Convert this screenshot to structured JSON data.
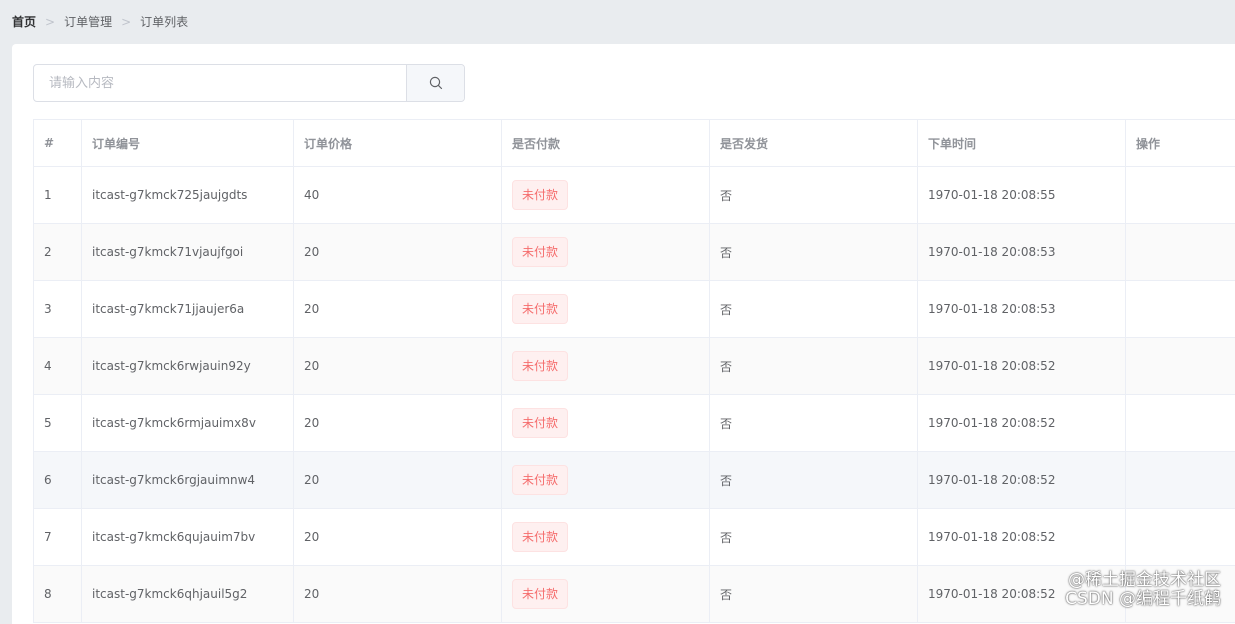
{
  "breadcrumb": {
    "items": [
      "首页",
      "订单管理",
      "订单列表"
    ]
  },
  "search": {
    "placeholder": "请输入内容",
    "value": "",
    "icon": "search-icon"
  },
  "table": {
    "columns": [
      "#",
      "订单编号",
      "订单价格",
      "是否付款",
      "是否发货",
      "下单时间",
      "操作"
    ],
    "rows": [
      {
        "index": "1",
        "order_no": "itcast-g7kmck725jaujgdts",
        "price": "40",
        "paid": "未付款",
        "shipped": "否",
        "time": "1970-01-18 20:08:55",
        "actions": ""
      },
      {
        "index": "2",
        "order_no": "itcast-g7kmck71vjaujfgoi",
        "price": "20",
        "paid": "未付款",
        "shipped": "否",
        "time": "1970-01-18 20:08:53",
        "actions": ""
      },
      {
        "index": "3",
        "order_no": "itcast-g7kmck71jjaujer6a",
        "price": "20",
        "paid": "未付款",
        "shipped": "否",
        "time": "1970-01-18 20:08:53",
        "actions": ""
      },
      {
        "index": "4",
        "order_no": "itcast-g7kmck6rwjauin92y",
        "price": "20",
        "paid": "未付款",
        "shipped": "否",
        "time": "1970-01-18 20:08:52",
        "actions": ""
      },
      {
        "index": "5",
        "order_no": "itcast-g7kmck6rmjauimx8v",
        "price": "20",
        "paid": "未付款",
        "shipped": "否",
        "time": "1970-01-18 20:08:52",
        "actions": ""
      },
      {
        "index": "6",
        "order_no": "itcast-g7kmck6rgjauimnw4",
        "price": "20",
        "paid": "未付款",
        "shipped": "否",
        "time": "1970-01-18 20:08:52",
        "actions": ""
      },
      {
        "index": "7",
        "order_no": "itcast-g7kmck6qujauim7bv",
        "price": "20",
        "paid": "未付款",
        "shipped": "否",
        "time": "1970-01-18 20:08:52",
        "actions": ""
      },
      {
        "index": "8",
        "order_no": "itcast-g7kmck6qhjauil5g2",
        "price": "20",
        "paid": "未付款",
        "shipped": "否",
        "time": "1970-01-18 20:08:52",
        "actions": ""
      }
    ]
  },
  "watermark": {
    "line1": "@稀土掘金技术社区",
    "line2": "CSDN @编程千纸鹤"
  },
  "colors": {
    "page_bg": "#e9ecef",
    "tag_danger_text": "#f56c6c",
    "tag_danger_bg": "#fef0f0",
    "stripe": "#fafafa",
    "hover_row": "#f5f7fa"
  }
}
